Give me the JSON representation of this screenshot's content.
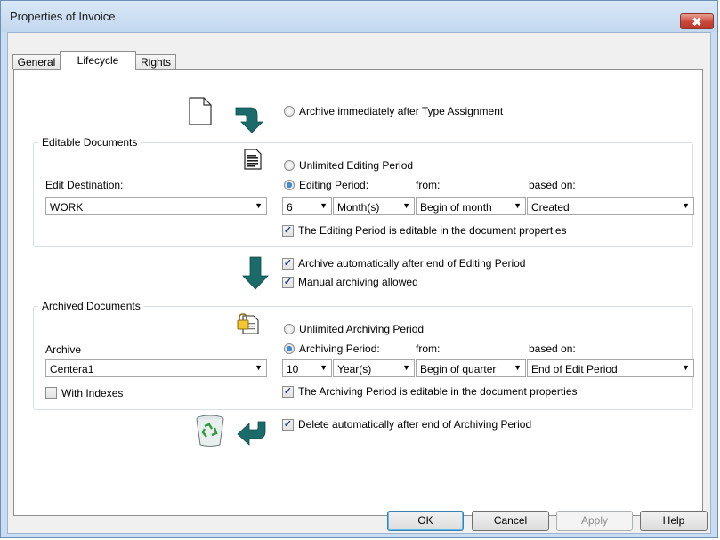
{
  "window": {
    "title": "Properties of Invoice",
    "close_label": "✖"
  },
  "tabs": [
    {
      "label": "General"
    },
    {
      "label": "Lifecycle"
    },
    {
      "label": "Rights"
    }
  ],
  "archive_immediately": {
    "label": "Archive immediately after Type Assignment"
  },
  "editable": {
    "group_title": "Editable Documents",
    "unlimited_label": "Unlimited Editing Period",
    "period_label": "Editing Period:",
    "from_label": "from:",
    "based_on_label": "based on:",
    "destination_label": "Edit Destination:",
    "destination_value": "WORK",
    "period_value": "6",
    "unit_value": "Month(s)",
    "from_value": "Begin of month",
    "based_on_value": "Created",
    "editable_check_label": "The Editing Period is editable in the document properties"
  },
  "archive_auto_label": "Archive automatically after end of Editing Period",
  "manual_archiving_label": "Manual archiving allowed",
  "archived": {
    "group_title": "Archived Documents",
    "unlimited_label": "Unlimited Archiving Period",
    "period_label": "Archiving Period:",
    "from_label": "from:",
    "based_on_label": "based on:",
    "archive_label": "Archive",
    "archive_value": "Centera1",
    "with_indexes_label": "With Indexes",
    "period_value": "10",
    "unit_value": "Year(s)",
    "from_value": "Begin of quarter",
    "based_on_value": "End of Edit Period",
    "editable_check_label": "The Archiving Period is editable in the document properties"
  },
  "delete_auto_label": "Delete automatically after end of Archiving Period",
  "buttons": {
    "ok": "OK",
    "cancel": "Cancel",
    "apply": "Apply",
    "help": "Help"
  },
  "icons": {
    "arrow_color": "#1c6b6b",
    "document": "document-icon",
    "recycle": "recycle-bin-icon"
  }
}
